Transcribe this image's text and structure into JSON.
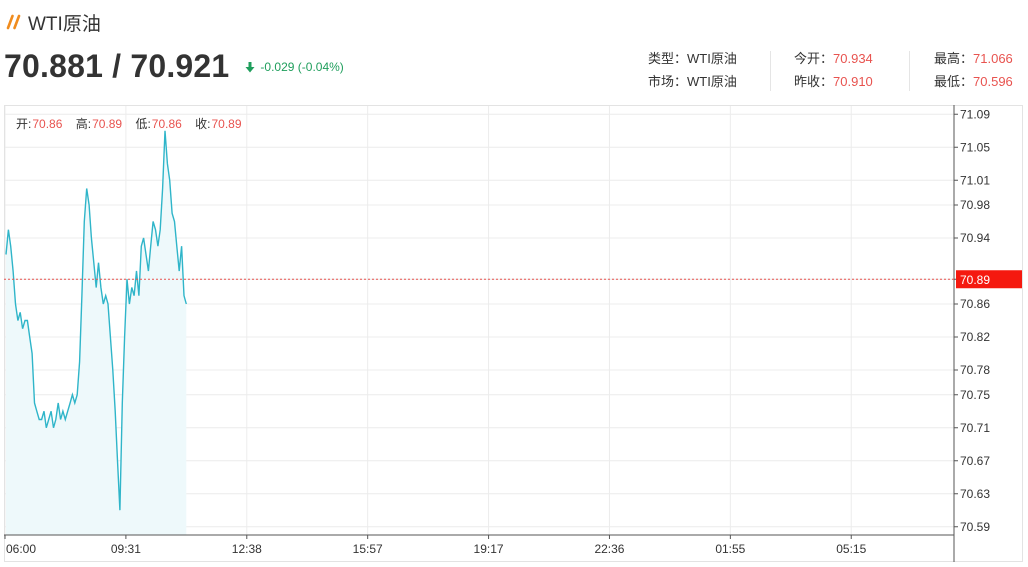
{
  "header": {
    "title": "WTI原油",
    "bid_ask": "70.881 / 70.921",
    "change": "-0.029 (-0.04%)",
    "icons": {
      "brand": "double-slash-icon",
      "change": "arrow-down-icon"
    },
    "colors": {
      "accent": "#f08c1e",
      "up": "#e8534f",
      "down": "#1f9e5c",
      "line": "#2fb5c9",
      "fill": "#eef9fb"
    }
  },
  "stats": {
    "type_label": "类型：",
    "type_value": "WTI原油",
    "market_label": "市场：",
    "market_value": "WTI原油",
    "open_label": "今开：",
    "open_value": "70.934",
    "prev_close_label": "昨收：",
    "prev_close_value": "70.910",
    "high_label": "最高：",
    "high_value": "71.066",
    "low_label": "最低：",
    "low_value": "70.596"
  },
  "ohlc": {
    "open_label": "开:",
    "open": "70.86",
    "high_label": "高:",
    "high": "70.89",
    "low_label": "低:",
    "low": "70.86",
    "close_label": "收:",
    "close": "70.89"
  },
  "chart_data": {
    "type": "area",
    "title": "",
    "xlabel": "",
    "ylabel": "",
    "x_ticks": [
      "06:00",
      "09:31",
      "12:38",
      "15:57",
      "19:17",
      "22:36",
      "01:55",
      "05:15"
    ],
    "y_ticks": [
      70.59,
      70.63,
      70.67,
      70.71,
      70.75,
      70.78,
      70.82,
      70.86,
      70.89,
      70.94,
      70.98,
      71.01,
      71.05,
      71.09
    ],
    "ylim": [
      70.58,
      71.1
    ],
    "current_price": 70.89,
    "current_price_label": "70.89",
    "grid": true,
    "series": [
      {
        "values": [
          70.92,
          70.95,
          70.93,
          70.9,
          70.86,
          70.84,
          70.85,
          70.83,
          70.84,
          70.84,
          70.82,
          70.8,
          70.74,
          70.73,
          70.72,
          70.72,
          70.73,
          70.71,
          70.72,
          70.73,
          70.71,
          70.72,
          70.74,
          70.72,
          70.73,
          70.72,
          70.73,
          70.74,
          70.75,
          70.74,
          70.75,
          70.79,
          70.87,
          70.96,
          71.0,
          70.98,
          70.94,
          70.91,
          70.88,
          70.91,
          70.88,
          70.86,
          70.87,
          70.86,
          70.82,
          70.78,
          70.73,
          70.67,
          70.61,
          70.74,
          70.82,
          70.89,
          70.86,
          70.88,
          70.87,
          70.9,
          70.87,
          70.93,
          70.94,
          70.92,
          70.9,
          70.93,
          70.96,
          70.95,
          70.93,
          70.95,
          71.0,
          71.07,
          71.03,
          71.01,
          70.97,
          70.96,
          70.93,
          70.9,
          70.93,
          70.87,
          70.86
        ]
      }
    ]
  }
}
